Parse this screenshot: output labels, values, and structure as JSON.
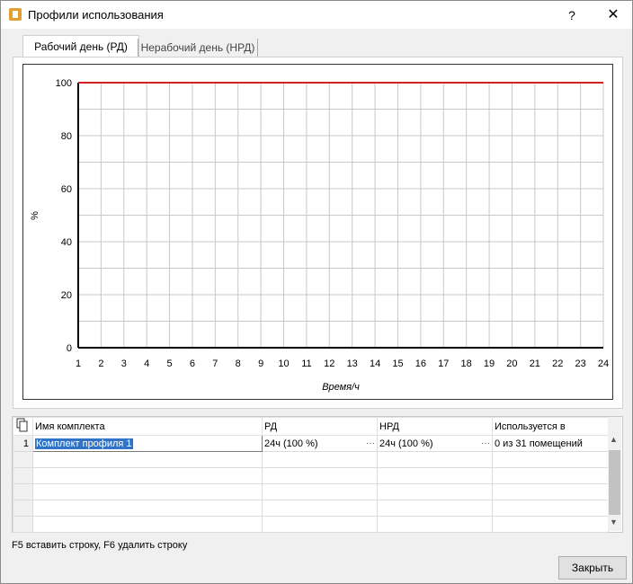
{
  "window": {
    "title": "Профили использования",
    "help": "?",
    "close": "✕"
  },
  "tabs": [
    {
      "label": "Рабочий день (РД)",
      "active": true
    },
    {
      "label": "Нерабочий день (НРД)",
      "active": false
    }
  ],
  "chart_data": {
    "type": "line",
    "ylabel": "%",
    "xlabel": "Время/ч",
    "x": [
      1,
      2,
      3,
      4,
      5,
      6,
      7,
      8,
      9,
      10,
      11,
      12,
      13,
      14,
      15,
      16,
      17,
      18,
      19,
      20,
      21,
      22,
      23,
      24
    ],
    "xlim": [
      1,
      24
    ],
    "ylim": [
      0,
      100
    ],
    "yticks": [
      0,
      20,
      40,
      60,
      80,
      100
    ],
    "series": [
      {
        "values": [
          100,
          100,
          100,
          100,
          100,
          100,
          100,
          100,
          100,
          100,
          100,
          100,
          100,
          100,
          100,
          100,
          100,
          100,
          100,
          100,
          100,
          100,
          100,
          100
        ],
        "color": "#d42020"
      }
    ],
    "grid": true
  },
  "table": {
    "columns": [
      "Имя комплекта",
      "РД",
      "НРД",
      "Используется в"
    ],
    "rows": [
      {
        "num": "1",
        "name": "Комплект профиля 1",
        "rd": "24ч (100 %)",
        "nrd": "24ч (100 %)",
        "used": "0 из 31 помещений"
      }
    ],
    "ellipsis": "···"
  },
  "hint": "F5 вставить строку, F6 удалить строку",
  "buttons": {
    "close": "Закрыть"
  },
  "icons": {
    "copy": "copy-icon"
  }
}
